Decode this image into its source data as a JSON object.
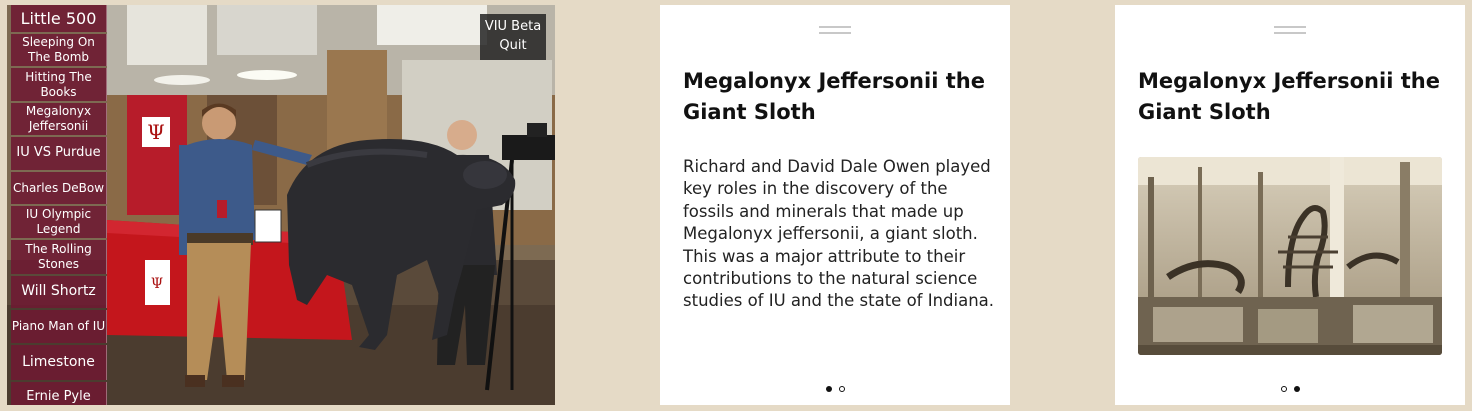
{
  "ar_view": {
    "menu_items": [
      {
        "label": "Little 500",
        "size": "md"
      },
      {
        "label": "Sleeping On The Bomb",
        "size": "sm"
      },
      {
        "label": "Hitting The Books",
        "size": "sm"
      },
      {
        "label": "Megalonyx Jeffersonii",
        "size": "sm"
      },
      {
        "label": "IU VS Purdue",
        "size": "md"
      },
      {
        "label": "Charles DeBow",
        "size": "sm"
      },
      {
        "label": "IU Olympic Legend",
        "size": "sm"
      },
      {
        "label": "The Rolling Stones",
        "size": "sm"
      },
      {
        "label": "Will Shortz",
        "size": "lg"
      },
      {
        "label": "Piano Man of IU",
        "size": "sm"
      },
      {
        "label": "Limestone",
        "size": "lg"
      },
      {
        "label": "Ernie Pyle",
        "size": "md"
      }
    ],
    "app_name": "VIU Beta",
    "quit_label": "Quit"
  },
  "text_card": {
    "title": "Megalonyx Jeffersonii the Giant Sloth",
    "body": "Richard and David Dale Owen played key roles in the discovery of the fossils and minerals that made up Megalonyx jeffersonii, a giant sloth. This was a major attribute to their contributions to the natural science studies of IU and the state of Indiana.",
    "page_dots": [
      true,
      false
    ]
  },
  "image_card": {
    "title": "Megalonyx Jeffersonii the Giant Sloth",
    "photo_icon": "museum-fossil-photo",
    "page_dots": [
      false,
      true
    ]
  },
  "colors": {
    "background": "#e5dac6",
    "menu_button": "#6e1932",
    "iu_crimson": "#990000"
  }
}
